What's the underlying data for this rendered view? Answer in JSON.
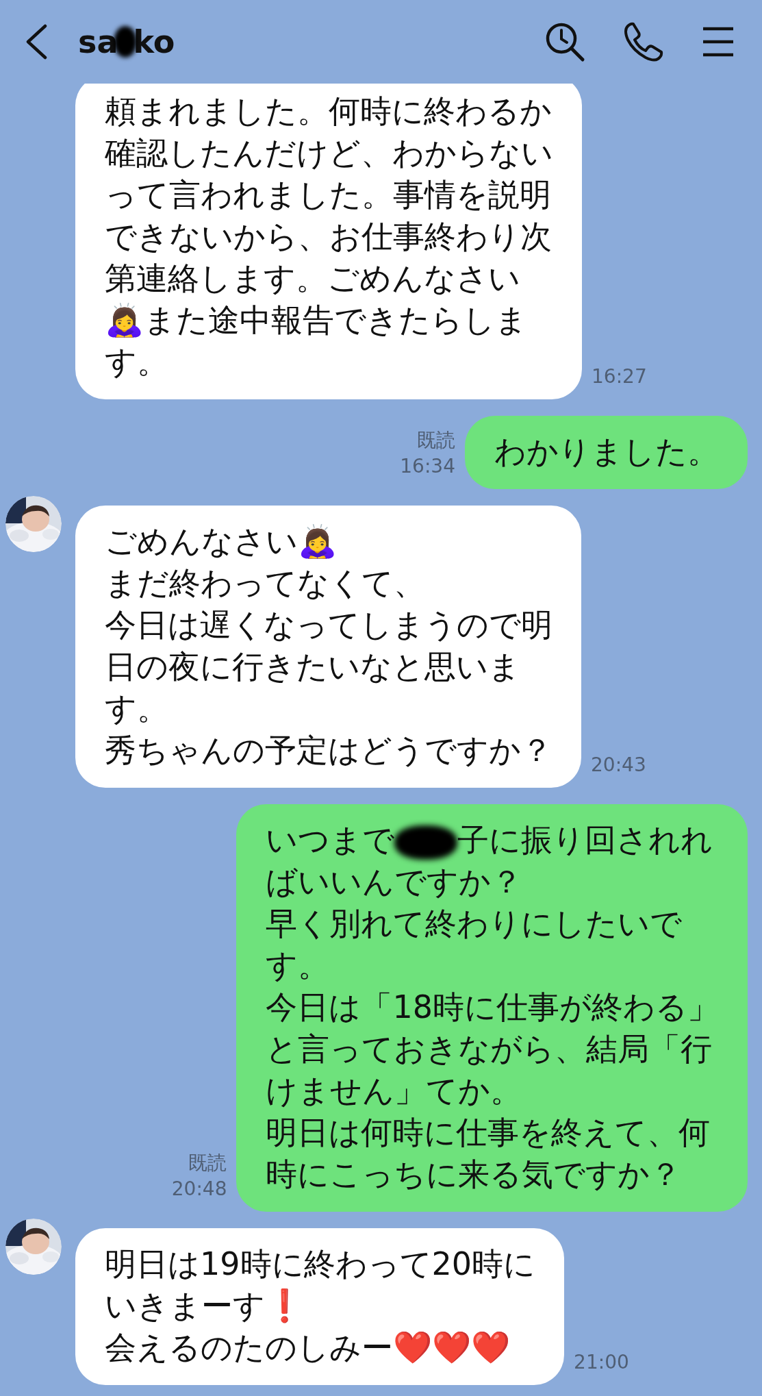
{
  "header": {
    "title": [
      {
        "kind": "text",
        "text": "sa"
      },
      {
        "kind": "redacted"
      },
      {
        "kind": "text",
        "text": "ko"
      }
    ]
  },
  "messages": [
    {
      "kind": "incoming",
      "show_avatar": false,
      "lines": [
        "頼まれました。何時に終わるか",
        "確認したんだけど、わからない",
        "って言われました。事情を説明",
        "できないから、お仕事終わり次",
        "第連絡します。ごめんなさい",
        "🙇‍♀️また途中報告できたらしま",
        "す。"
      ],
      "time": "16:27"
    },
    {
      "kind": "outgoing",
      "read_label": "既読",
      "lines": [
        "わかりました。"
      ],
      "time": "16:34"
    },
    {
      "kind": "incoming",
      "show_avatar": true,
      "lines": [
        "ごめんなさい🙇‍♀️",
        "まだ終わってなくて、",
        "今日は遅くなってしまうので明",
        "日の夜に行きたいなと思いま",
        "す。",
        "秀ちゃんの予定はどうですか？"
      ],
      "time": "20:43"
    },
    {
      "kind": "outgoing",
      "read_label": "既読",
      "lines": [
        {
          "segments": [
            {
              "kind": "text",
              "text": "いつまで"
            },
            {
              "kind": "redacted"
            },
            {
              "kind": "text",
              "text": "子に振り回されれ"
            }
          ]
        },
        "ばいいんですか？",
        "早く別れて終わりにしたいで",
        "す。",
        "今日は「18時に仕事が終わる」",
        "と言っておきながら、結局「行",
        "けません」てか。",
        "明日は何時に仕事を終えて、何",
        "時にこっちに来る気ですか？"
      ],
      "time": "20:48"
    },
    {
      "kind": "incoming",
      "show_avatar": true,
      "lines": [
        "明日は19時に終わって20時に",
        "いきまーす❗️",
        "会えるのたのしみー❤️❤️❤️"
      ],
      "time": "21:00"
    }
  ]
}
